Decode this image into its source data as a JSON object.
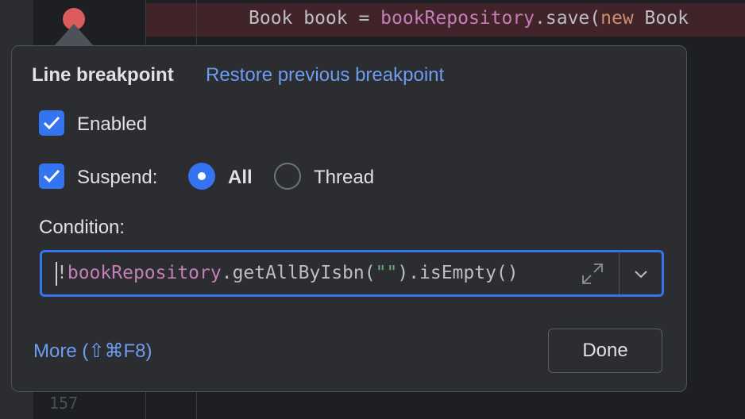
{
  "editor": {
    "code_line": {
      "part1": "Book book = ",
      "part2": "bookRepository",
      "part3": ".save(",
      "part4": "new",
      "part5": " Book"
    },
    "line_number": "157"
  },
  "popup": {
    "title": "Line breakpoint",
    "restore_link": "Restore previous breakpoint",
    "enabled": {
      "label": "Enabled",
      "checked": true
    },
    "suspend": {
      "label": "Suspend:",
      "checked": true,
      "options": [
        "All",
        "Thread"
      ],
      "selected": "All"
    },
    "condition": {
      "label": "Condition:",
      "value": {
        "p1": "!",
        "p2": "bookRepository",
        "p3": ".getAllByIsbn(",
        "p4": "\"\"",
        "p5": ").isEmpty()"
      }
    },
    "more_link": "More (⇧⌘F8)",
    "done_label": "Done"
  },
  "colors": {
    "accent": "#3574f0",
    "link": "#6d9cf0",
    "breakpoint": "#db5c5c"
  }
}
